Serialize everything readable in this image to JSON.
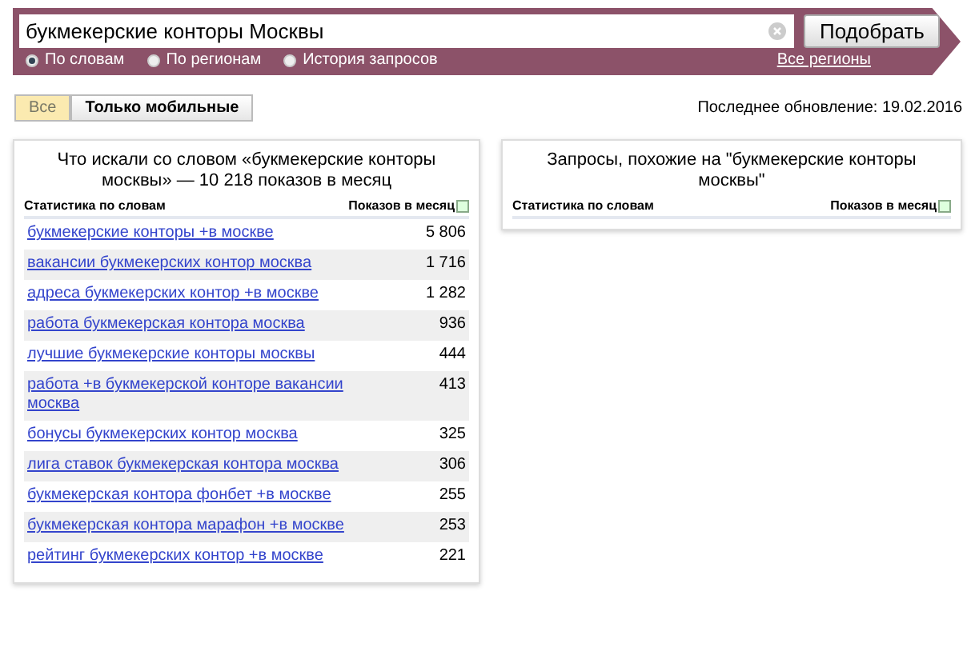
{
  "search": {
    "value": "букмекерские конторы Москвы",
    "button": "Подобрать"
  },
  "modes": [
    {
      "label": "По словам",
      "selected": true
    },
    {
      "label": "По регионам",
      "selected": false
    },
    {
      "label": "История запросов",
      "selected": false
    }
  ],
  "regions_link": "Все регионы",
  "filters": [
    {
      "label": "Все",
      "selected": true
    },
    {
      "label": "Только мобильные",
      "selected": false
    }
  ],
  "last_update": "Последнее обновление: 19.02.2016",
  "left_panel": {
    "title": "Что искали со словом «букмекерские конторы москвы» — 10 218 показов в месяц",
    "columns": [
      "Статистика по словам",
      "Показов в месяц"
    ],
    "rows": [
      {
        "phrase": "букмекерские конторы +в москве",
        "count": "5 806"
      },
      {
        "phrase": "вакансии букмекерских контор москва",
        "count": "1 716"
      },
      {
        "phrase": "адреса букмекерских контор +в москве",
        "count": "1 282"
      },
      {
        "phrase": "работа букмекерская контора москва",
        "count": "936"
      },
      {
        "phrase": "лучшие букмекерские конторы москвы",
        "count": "444"
      },
      {
        "phrase": "работа +в букмекерской конторе вакансии москва",
        "count": "413"
      },
      {
        "phrase": "бонусы букмекерских контор москва",
        "count": "325"
      },
      {
        "phrase": "лига ставок букмекерская контора москва",
        "count": "306"
      },
      {
        "phrase": "букмекерская контора фонбет +в москве",
        "count": "255"
      },
      {
        "phrase": "букмекерская контора марафон +в москве",
        "count": "253"
      },
      {
        "phrase": "рейтинг букмекерских контор +в москве",
        "count": "221"
      }
    ]
  },
  "right_panel": {
    "title": "Запросы, похожие на \"букмекерские конторы москвы\"",
    "columns": [
      "Статистика по словам",
      "Показов в месяц"
    ]
  }
}
